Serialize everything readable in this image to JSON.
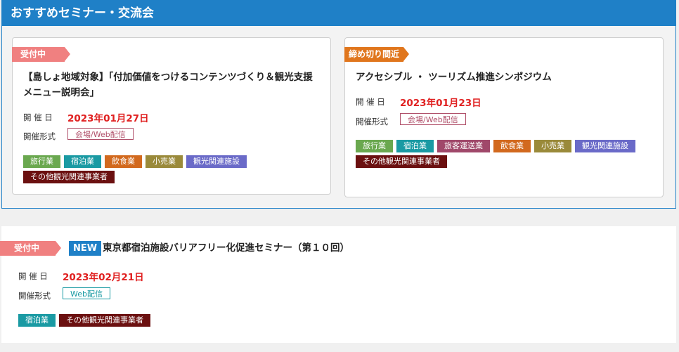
{
  "featured": {
    "title": "おすすめセミナー・交流会",
    "cards": [
      {
        "status": "受付中",
        "title_line1": "【島しょ地域対象】「付加価値をつけるコンテンツづくり＆観光支援",
        "title_line2": "メニュー説明会」",
        "date_label": "開 催 日",
        "date_value": "2023年01月27日",
        "format_label": "開催形式",
        "format_value": "会場/Web配信",
        "tags": [
          "旅行業",
          "宿泊業",
          "飲食業",
          "小売業",
          "観光関連施設",
          "その他観光関連事業者"
        ]
      },
      {
        "status": "締め切り間近",
        "title": "アクセシブル ・ ツーリズム推進シンポジウム",
        "date_label": "開 催 日",
        "date_value": "2023年01月23日",
        "format_label": "開催形式",
        "format_value": "会場/Web配信",
        "tags": [
          "旅行業",
          "宿泊業",
          "旅客運送業",
          "飲食業",
          "小売業",
          "観光関連施設",
          "その他観光関連事業者"
        ]
      }
    ]
  },
  "listing": {
    "status": "受付中",
    "new_badge": "NEW",
    "title": "東京都宿泊施設バリアフリー化促進セミナー（第１０回）",
    "date_label": "開 催 日",
    "date_value": "2023年02月21日",
    "format_label": "開催形式",
    "format_value": "Web配信",
    "tags": [
      "宿泊業",
      "その他観光関連事業者"
    ]
  },
  "colors": {
    "header_blue": "#1f80c7",
    "status_open": "#f08080",
    "status_closing": "#e0761d",
    "date_red": "#e02020",
    "tag_旅行業": "#6aa84f",
    "tag_宿泊業": "#1a9aa3",
    "tag_旅客運送業": "#a0486a",
    "tag_飲食業": "#d2691e",
    "tag_小売業": "#9a8a3a",
    "tag_観光関連施設": "#6a6ac8",
    "tag_その他観光関連事業者": "#6b1010"
  }
}
